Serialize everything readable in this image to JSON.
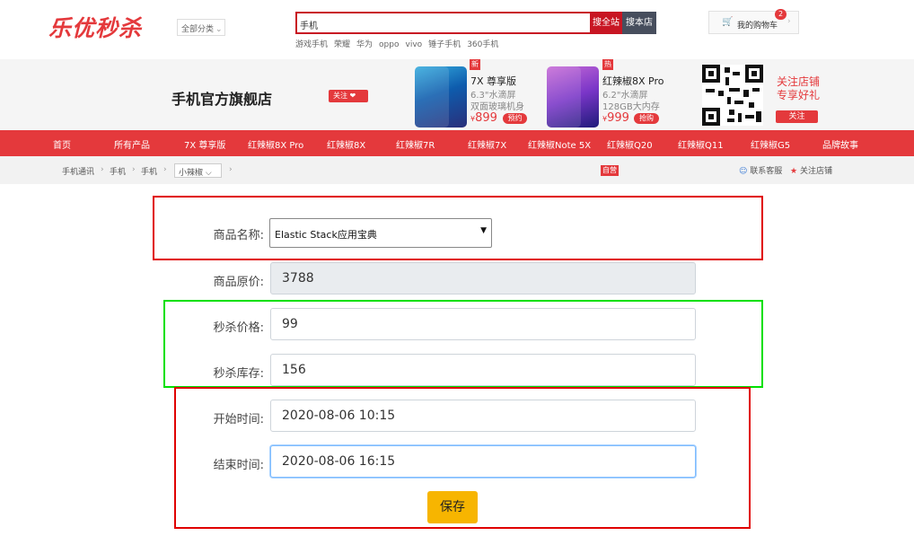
{
  "header": {
    "logo": "乐优秒杀",
    "category_select": "全部分类",
    "search_value": "手机",
    "search_all_label": "搜全站",
    "search_store_label": "搜本店",
    "hot_words": [
      "游戏手机",
      "荣耀",
      "华为",
      "oppo",
      "vivo",
      "锤子手机",
      "360手机"
    ],
    "cart_label": "我的购物车",
    "cart_count": "2"
  },
  "banner": {
    "store_name": "手机官方旗舰店",
    "follow_label": "关注",
    "products": [
      {
        "tag": "新",
        "name": "7X 尊享版",
        "desc1": "6.3\"水滴屏",
        "desc2": "双面玻璃机身",
        "price": "899",
        "action": "预约"
      },
      {
        "tag": "热",
        "name": "红辣椒8X Pro",
        "desc1": "6.2\"水滴屏",
        "desc2": "128GB大内存",
        "price": "999",
        "action": "抢购"
      }
    ],
    "qr_line1": "关注店铺",
    "qr_line2": "专享好礼",
    "qr_follow_label": "关注",
    "accent_color": "#e4393c"
  },
  "nav": {
    "items": [
      "首页",
      "所有产品",
      "7X 尊享版",
      "红辣椒8X Pro",
      "红辣椒8X",
      "红辣椒7R",
      "红辣椒7X",
      "红辣椒Note 5X",
      "红辣椒Q20",
      "红辣椒Q11",
      "红辣椒G5",
      "品牌故事"
    ]
  },
  "breadcrumb": {
    "items": [
      "手机通讯",
      "手机",
      "手机"
    ],
    "select_value": "小辣椒",
    "self_run": "自营",
    "service": "联系客服",
    "follow_store": "关注店铺"
  },
  "form": {
    "product_name_label": "商品名称:",
    "product_name_value": "Elastic Stack应用宝典",
    "original_price_label": "商品原价:",
    "original_price_value": "3788",
    "seckill_price_label": "秒杀价格:",
    "seckill_price_value": "99",
    "seckill_stock_label": "秒杀库存:",
    "seckill_stock_value": "156",
    "start_time_label": "开始时间:",
    "start_time_value": "2020-08-06 10:15",
    "end_time_label": "结束时间:",
    "end_time_value": "2020-08-06 16:15",
    "save_label": "保存",
    "save_color": "#f7b500"
  }
}
